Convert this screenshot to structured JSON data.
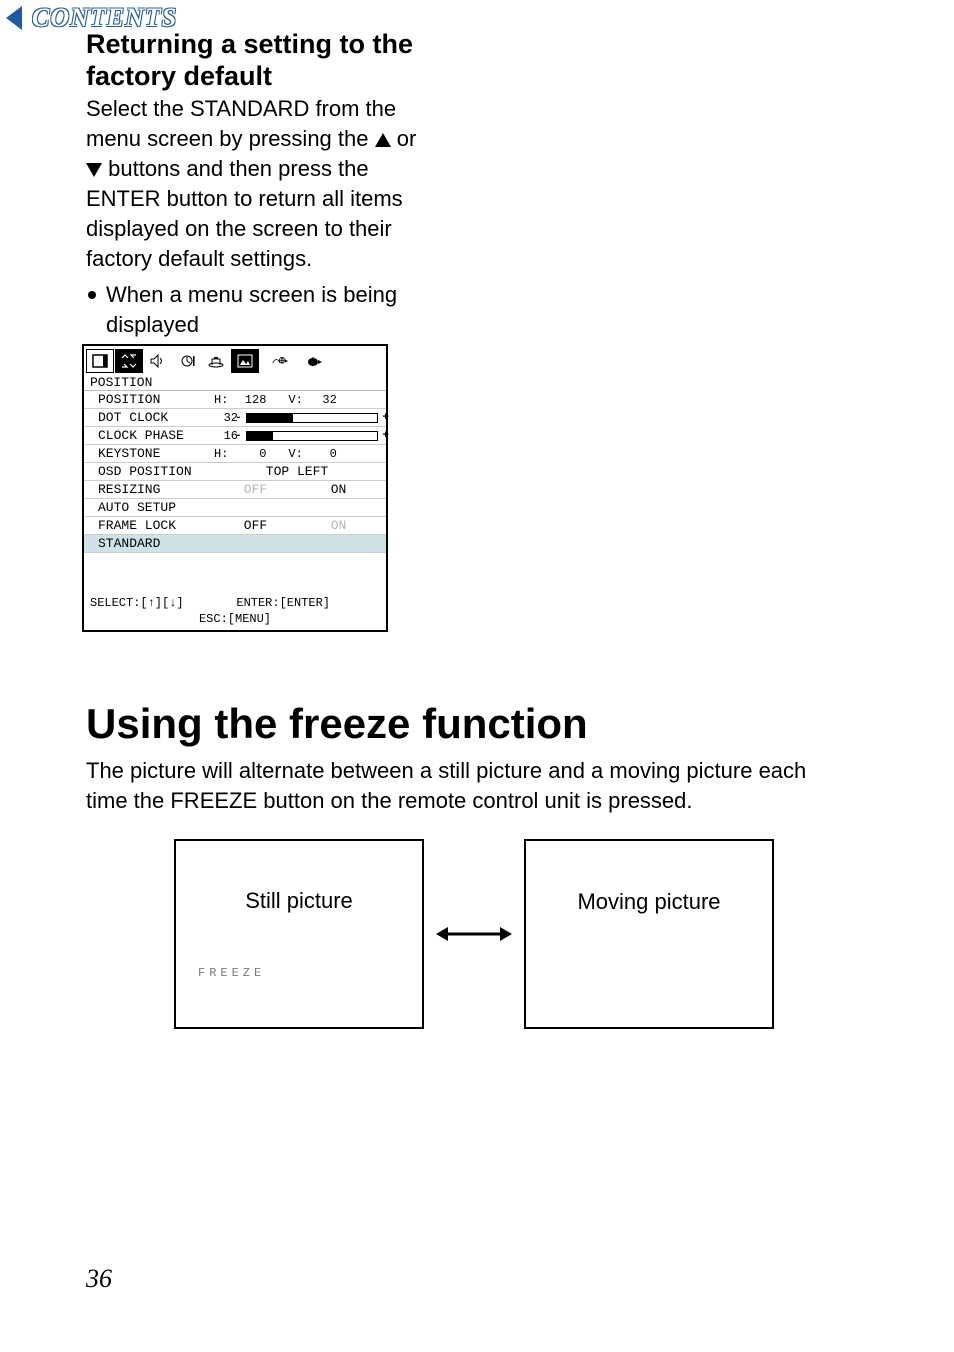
{
  "contents_tab": "CONTENTS",
  "section1": {
    "heading": "Returning a setting to the factory default",
    "para_before_up": "Select the STANDARD from the menu screen by pressing the ",
    "para_between": " or ",
    "para_after_down": " buttons and then press the ENTER button to return all items displayed on the screen to their factory default settings.",
    "bullet": "When a menu screen is being displayed"
  },
  "osd": {
    "title": "POSITION",
    "rows": {
      "position": {
        "label": "POSITION",
        "h_label": "H:",
        "h_val": "128",
        "v_label": "V:",
        "v_val": "32"
      },
      "dot_clock": {
        "label": "DOT CLOCK",
        "val": "32",
        "fill_pct": 35
      },
      "clock_phase": {
        "label": "CLOCK PHASE",
        "val": "16",
        "fill_pct": 20
      },
      "keystone": {
        "label": "KEYSTONE",
        "h_label": "H:",
        "h_val": "0",
        "v_label": "V:",
        "v_val": "0"
      },
      "osd_position": {
        "label": "OSD POSITION",
        "value": "TOP LEFT"
      },
      "resizing": {
        "label": "RESIZING",
        "off": "OFF",
        "on": "ON"
      },
      "auto_setup": {
        "label": "AUTO SETUP"
      },
      "frame_lock": {
        "label": "FRAME LOCK",
        "off": "OFF",
        "on": "ON"
      },
      "standard": {
        "label": "STANDARD"
      }
    },
    "footer": {
      "select": "SELECT:[↑][↓]",
      "enter": "ENTER:[ENTER]",
      "esc": "ESC:[MENU]"
    }
  },
  "section2": {
    "heading": "Using the freeze function",
    "para": "The picture will alternate between a still picture and a moving picture each time the FREEZE button on the remote control unit is pressed."
  },
  "diagram": {
    "left_box": "Still picture",
    "left_marker": "FREEZE",
    "right_box": "Moving picture"
  },
  "page_number": "36"
}
